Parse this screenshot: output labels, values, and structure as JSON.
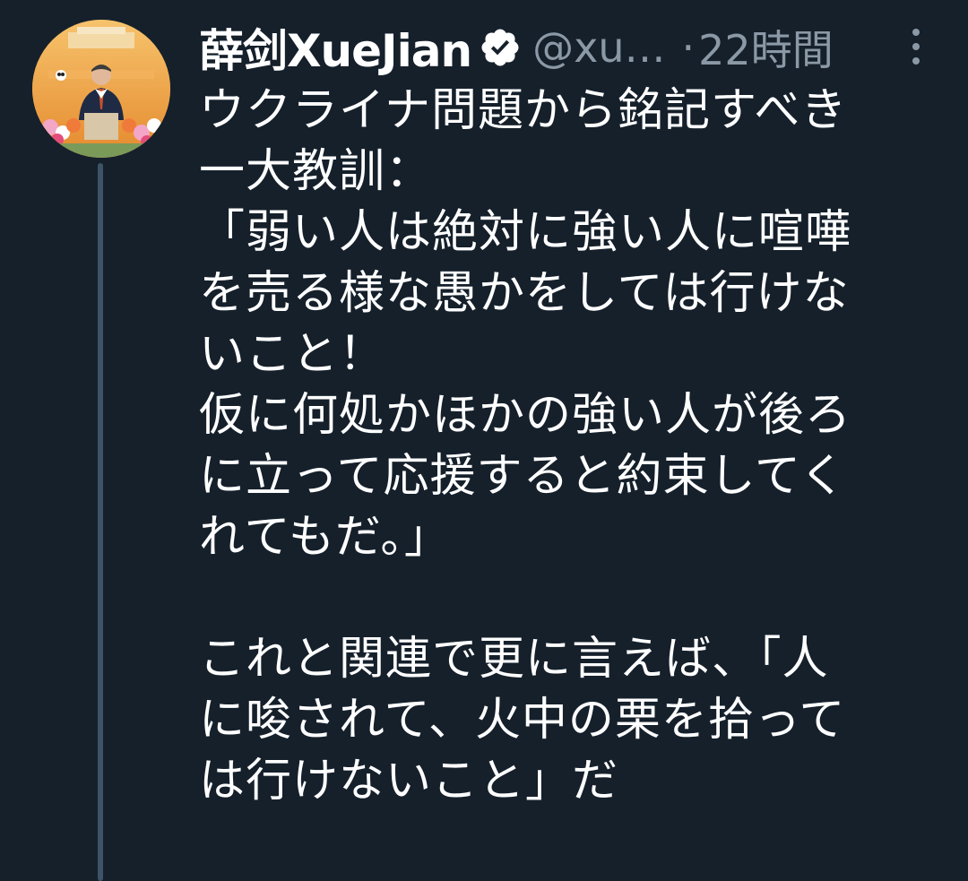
{
  "tweet": {
    "display_name": "薛剑XueJian",
    "handle": "@xu…",
    "separator": "·",
    "time": "22時間",
    "lines": [
      "ウクライナ問題から銘記すべき",
      "一大教訓：",
      "「弱い人は絶対に強い人に喧嘩",
      "を売る様な愚かをしては行けな",
      "いこと！",
      "仮に何処かほかの強い人が後ろ",
      "に立って応援すると約束してく",
      "れてもだ。」",
      "",
      "これと関連で更に言えば、「人",
      "に唆されて、火中の栗を拾って",
      "は行けないこと」だ"
    ]
  },
  "icons": {
    "verified": "verified-badge-icon",
    "more": "more-options-icon"
  },
  "colors": {
    "background": "#15202b",
    "secondary_text": "#8b98a5",
    "thread_line": "#3d5466"
  }
}
